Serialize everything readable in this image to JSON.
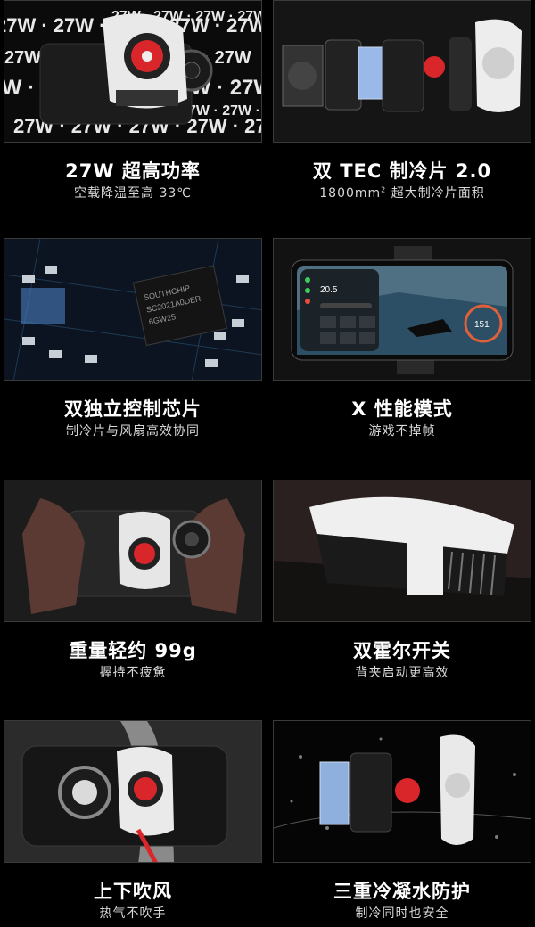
{
  "features": [
    {
      "title": "27W 超高功率",
      "subtitle": "空载降温至高 33℃"
    },
    {
      "title": "双 TEC 制冷片 2.0",
      "subtitle_pre": "1800mm",
      "subtitle_sup": "2",
      "subtitle_post": " 超大制冷片面积"
    },
    {
      "title": "双独立控制芯片",
      "subtitle": "制冷片与风扇高效协同"
    },
    {
      "title": "X 性能模式",
      "subtitle": "游戏不掉帧"
    },
    {
      "title": "重量轻约 99g",
      "subtitle": "握持不疲惫"
    },
    {
      "title": "双霍尔开关",
      "subtitle": "背夹启动更高效"
    },
    {
      "title": "上下吹风",
      "subtitle": "热气不吹手"
    },
    {
      "title": "三重冷凝水防护",
      "subtitle": "制冷同时也安全"
    }
  ],
  "images": {
    "power_bg_text": "27W · 27W · 27W · 27W · 27W",
    "chip_text": [
      "SOUTHCHIP",
      "SC2021A0DER",
      "6GW25"
    ],
    "game_temp": "20.5",
    "game_score": "151",
    "accent": "#d8262a"
  }
}
